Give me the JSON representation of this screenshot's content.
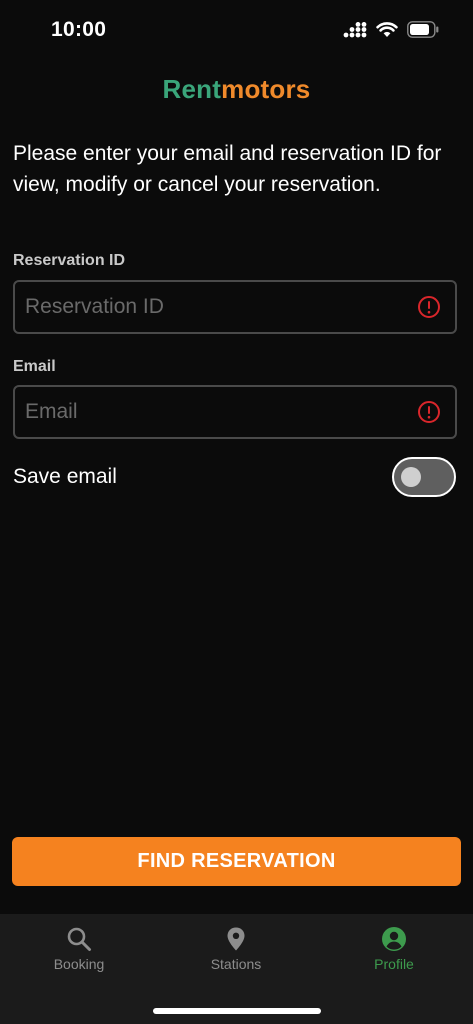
{
  "status_bar": {
    "time": "10:00"
  },
  "logo": {
    "part1": "Rent",
    "part2": "motors"
  },
  "intro_text": "Please enter your email and reservation ID for view, modify or cancel your reservation.",
  "form": {
    "reservation_id": {
      "label": "Reservation ID",
      "placeholder": "Reservation ID",
      "value": ""
    },
    "email": {
      "label": "Email",
      "placeholder": "Email",
      "value": ""
    },
    "save_email": {
      "label": "Save email",
      "checked": false
    }
  },
  "find_button_label": "FIND RESERVATION",
  "tabs": [
    {
      "label": "Booking",
      "icon": "search-icon",
      "active": false
    },
    {
      "label": "Stations",
      "icon": "location-pin-icon",
      "active": false
    },
    {
      "label": "Profile",
      "icon": "profile-icon",
      "active": true
    }
  ],
  "colors": {
    "background": "#0b0b0b",
    "accent_orange": "#f5821f",
    "brand_green": "#3aa57a",
    "error_red": "#d9262b",
    "active_tab": "#3d9b4d"
  }
}
